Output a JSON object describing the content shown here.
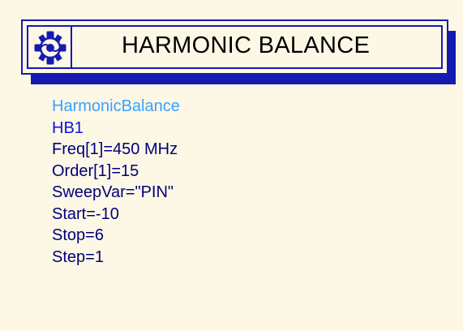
{
  "component": {
    "title": "HARMONIC BALANCE",
    "icon": "harmonic-balance-gear-icon",
    "type_name": "HarmonicBalance",
    "instance_name": "HB1"
  },
  "parameters": [
    "Freq[1]=450 MHz",
    "Order[1]=15",
    "SweepVar=\"PIN\"",
    "Start=-10",
    "Stop=6",
    "Step=1"
  ],
  "colors": {
    "background": "#fdf8e6",
    "frame": "#161ab0",
    "type_text": "#3aa0ff",
    "instance_text": "#1010e8",
    "param_text": "#00007a"
  }
}
